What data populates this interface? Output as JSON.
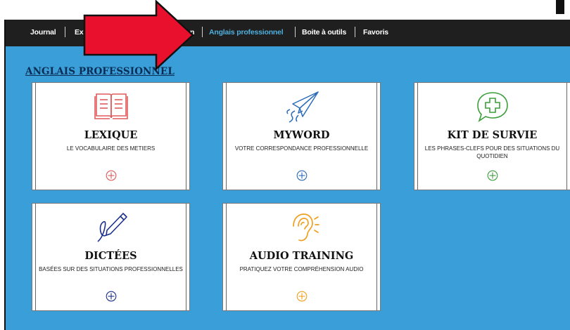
{
  "nav": {
    "items": [
      {
        "label": "Journal"
      },
      {
        "label": "Exer"
      },
      {
        "label": "n"
      },
      {
        "label": "Anglais professionnel"
      },
      {
        "label": "Boite à outils"
      },
      {
        "label": "Favoris"
      }
    ],
    "active_color": "#4fb0df"
  },
  "section_title": "ANGLAIS PROFESSIONNEL",
  "cards": [
    {
      "title": "LEXIQUE",
      "subtitle": "LE VOCABULAIRE DES METIERS",
      "icon": "book-icon",
      "color": "#e05a5a"
    },
    {
      "title": "MYWORD",
      "subtitle": "VOTRE CORRESPONDANCE PROFESSIONNELLE",
      "icon": "paper-plane-icon",
      "color": "#2b6cb8"
    },
    {
      "title": "KIT DE SURVIE",
      "subtitle": "LES PHRASES-CLEFS POUR DES SITUATIONS DU QUOTIDIEN",
      "icon": "first-aid-chat-icon",
      "color": "#3a9e3a"
    },
    {
      "title": "DICTÉES",
      "subtitle": "BASÉES SUR DES SITUATIONS PROFESSIONNELLES",
      "icon": "pen-icon",
      "color": "#1a2f8c"
    },
    {
      "title": "AUDIO TRAINING",
      "subtitle": "PRATIQUEZ VOTRE COMPRÉHENSION AUDIO",
      "icon": "ear-icon",
      "color": "#f0a020"
    }
  ],
  "colors": {
    "background": "#3a9fd8",
    "topbar": "#1f1f1f",
    "arrow": "#e8102c"
  }
}
